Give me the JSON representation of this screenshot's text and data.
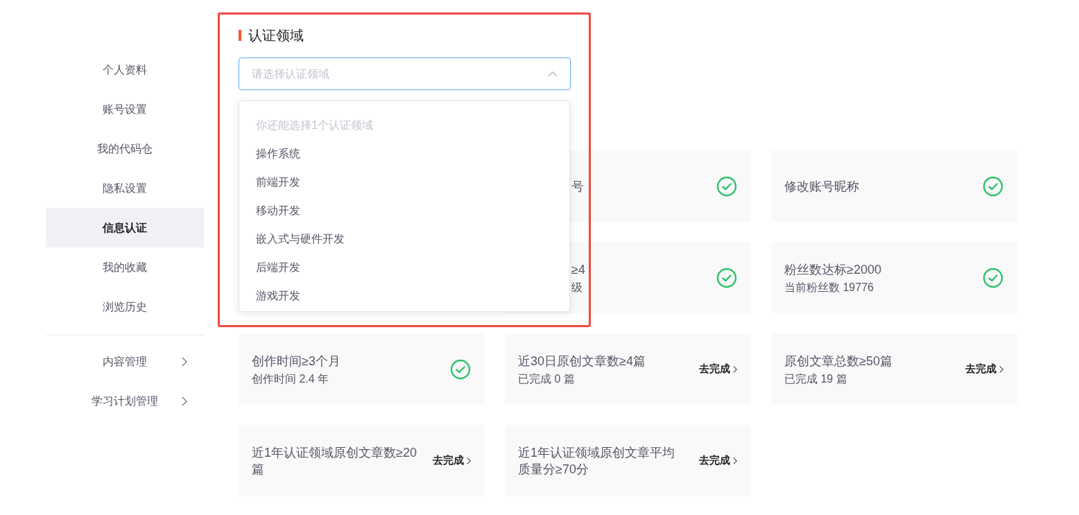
{
  "sidebar": {
    "items": [
      {
        "label": "个人资料",
        "selected": false
      },
      {
        "label": "账号设置",
        "selected": false
      },
      {
        "label": "我的代码仓",
        "selected": false
      },
      {
        "label": "隐私设置",
        "selected": false
      },
      {
        "label": "信息认证",
        "selected": true
      },
      {
        "label": "我的收藏",
        "selected": false
      },
      {
        "label": "浏览历史",
        "selected": false
      }
    ],
    "groups": [
      {
        "label": "内容管理",
        "expanded": false
      },
      {
        "label": "学习计划管理",
        "expanded": false
      }
    ]
  },
  "section": {
    "title": "认证领域",
    "select": {
      "placeholder": "请选择认证领域",
      "expanded": true,
      "dropdown": {
        "hint": "你还能选择1个认证领域",
        "options": [
          "操作系统",
          "前端开发",
          "移动开发",
          "嵌入式与硬件开发",
          "后端开发",
          "游戏开发"
        ]
      }
    }
  },
  "cards": [
    {
      "kind": "covered",
      "title": "号",
      "done": true
    },
    {
      "kind": "full",
      "title": "修改账号昵称",
      "done": true
    },
    {
      "kind": "covered",
      "title": "≥4",
      "subtitle": "级",
      "done": true
    },
    {
      "kind": "full",
      "title": "粉丝数达标≥2000",
      "subtitle": "当前粉丝数 19776",
      "done": true
    },
    {
      "kind": "full",
      "title": "创作时间≥3个月",
      "subtitle": "创作时间 2.4 年",
      "done": true
    },
    {
      "kind": "full",
      "title": "近30日原创文章数≥4篇",
      "subtitle": "已完成 0 篇",
      "done": false,
      "action": "去完成"
    },
    {
      "kind": "full",
      "title": "原创文章总数≥50篇",
      "subtitle": "已完成 19 篇",
      "done": false,
      "action": "去完成"
    },
    {
      "kind": "full",
      "title": "近1年认证领域原创文章数≥20篇",
      "done": false,
      "action": "去完成"
    },
    {
      "kind": "full",
      "title": "近1年认证领域原创文章平均质量分≥70分",
      "done": false,
      "action": "去完成"
    }
  ]
}
